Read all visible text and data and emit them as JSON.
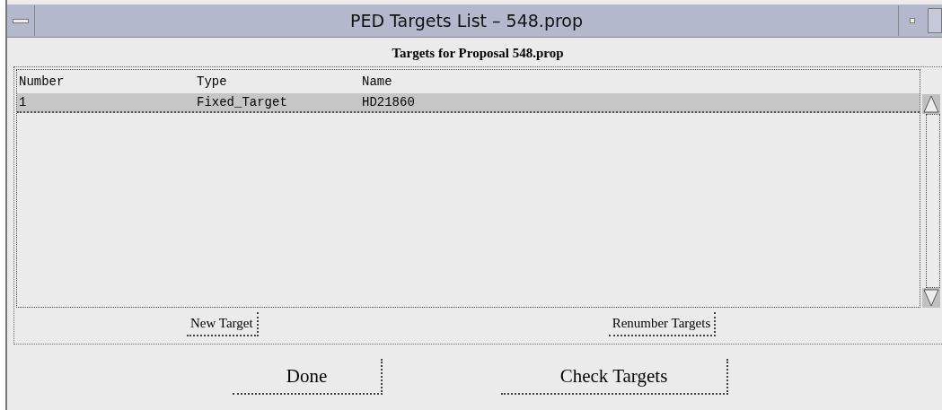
{
  "window": {
    "title": "PED Targets List – 548.prop"
  },
  "heading": "Targets for Proposal 548.prop",
  "table": {
    "columns": [
      "Number",
      "Type",
      "Name"
    ],
    "rows": [
      {
        "cells": [
          "1",
          "Fixed_Target",
          "HD21860"
        ],
        "selected": true
      }
    ]
  },
  "list_buttons": [
    "New Target",
    "Renumber Targets"
  ],
  "buttons": [
    "Done",
    "Check Targets"
  ]
}
